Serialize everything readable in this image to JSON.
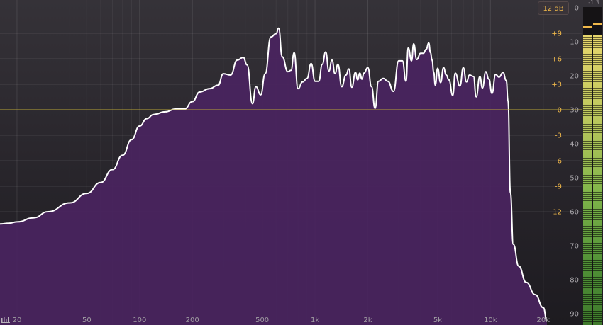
{
  "range_button": {
    "label": "12 dB"
  },
  "peak_readout": "-1.3",
  "gain_scale": [
    {
      "label": "+9",
      "db": 9
    },
    {
      "label": "+6",
      "db": 6
    },
    {
      "label": "+3",
      "db": 3
    },
    {
      "label": "0",
      "db": 0
    },
    {
      "label": "-3",
      "db": -3
    },
    {
      "label": "-6",
      "db": -6
    },
    {
      "label": "-9",
      "db": -9
    },
    {
      "label": "-12",
      "db": -12
    }
  ],
  "level_scale": [
    {
      "label": "0",
      "db": 0
    },
    {
      "label": "-10",
      "db": -10
    },
    {
      "label": "-20",
      "db": -20
    },
    {
      "label": "-30",
      "db": -30
    },
    {
      "label": "-40",
      "db": -40
    },
    {
      "label": "-50",
      "db": -50
    },
    {
      "label": "-60",
      "db": -60
    },
    {
      "label": "-70",
      "db": -70
    },
    {
      "label": "-80",
      "db": -80
    },
    {
      "label": "-90",
      "db": -90
    }
  ],
  "freq_labels": [
    {
      "label": "20",
      "hz": 20
    },
    {
      "label": "50",
      "hz": 50
    },
    {
      "label": "100",
      "hz": 100
    },
    {
      "label": "200",
      "hz": 200
    },
    {
      "label": "500",
      "hz": 500
    },
    {
      "label": "1k",
      "hz": 1000
    },
    {
      "label": "2k",
      "hz": 2000
    },
    {
      "label": "5k",
      "hz": 5000
    },
    {
      "label": "10k",
      "hz": 10000
    },
    {
      "label": "20k",
      "hz": 20000
    }
  ],
  "colors": {
    "spectrum_fill": "#4a2460",
    "spectrum_line": "#ffffff",
    "zero_line": "#b8a437",
    "gain_label": "#f0b84a",
    "level_label": "#a7a4a9",
    "freq_label": "#a19ea3",
    "meter_peak": "#f0b84a"
  },
  "meter": {
    "left_level_db": -8,
    "right_level_db": -8,
    "left_peak_db": -5.5,
    "right_peak_db": -4.5
  },
  "icons": {
    "corner": "analyzer-bars-icon"
  },
  "chart_data": {
    "type": "area",
    "x_scale": "log",
    "x_range_hz": [
      16,
      22000
    ],
    "y_range_db": [
      -92,
      2
    ],
    "points": [
      [
        16,
        -63.6
      ],
      [
        18,
        -63.4
      ],
      [
        20,
        -63
      ],
      [
        25,
        -61.8
      ],
      [
        30,
        -60
      ],
      [
        40,
        -57.4
      ],
      [
        50,
        -54.6
      ],
      [
        60,
        -51.4
      ],
      [
        70,
        -47.6
      ],
      [
        80,
        -43.4
      ],
      [
        90,
        -38.8
      ],
      [
        100,
        -34.8
      ],
      [
        110,
        -32.6
      ],
      [
        120,
        -31.4
      ],
      [
        140,
        -30.6
      ],
      [
        160,
        -29.8
      ],
      [
        180,
        -29.8
      ],
      [
        200,
        -27.6
      ],
      [
        220,
        -24.8
      ],
      [
        250,
        -23.8
      ],
      [
        280,
        -22.8
      ],
      [
        300,
        -19.4
      ],
      [
        330,
        -19.8
      ],
      [
        360,
        -15.4
      ],
      [
        390,
        -14.6
      ],
      [
        410,
        -16.8
      ],
      [
        440,
        -28.2
      ],
      [
        460,
        -23.2
      ],
      [
        490,
        -25.6
      ],
      [
        520,
        -19.4
      ],
      [
        560,
        -8.6
      ],
      [
        600,
        -7.6
      ],
      [
        620,
        -6
      ],
      [
        650,
        -14.4
      ],
      [
        700,
        -18.8
      ],
      [
        730,
        -18.4
      ],
      [
        760,
        -13.2
      ],
      [
        800,
        -23.8
      ],
      [
        850,
        -21.8
      ],
      [
        900,
        -20.8
      ],
      [
        950,
        -16.4
      ],
      [
        1000,
        -21.6
      ],
      [
        1050,
        -21.6
      ],
      [
        1100,
        -16.6
      ],
      [
        1150,
        -13
      ],
      [
        1200,
        -18.6
      ],
      [
        1250,
        -15.4
      ],
      [
        1300,
        -19.4
      ],
      [
        1350,
        -16.6
      ],
      [
        1420,
        -23.2
      ],
      [
        1500,
        -19.8
      ],
      [
        1560,
        -18
      ],
      [
        1620,
        -23.4
      ],
      [
        1700,
        -19
      ],
      [
        1750,
        -21.2
      ],
      [
        1800,
        -19.2
      ],
      [
        1850,
        -21
      ],
      [
        1900,
        -19.2
      ],
      [
        2000,
        -17.6
      ],
      [
        2100,
        -23.2
      ],
      [
        2200,
        -29.6
      ],
      [
        2300,
        -21.6
      ],
      [
        2450,
        -20.8
      ],
      [
        2600,
        -21.6
      ],
      [
        2800,
        -24.6
      ],
      [
        3000,
        -15.6
      ],
      [
        3150,
        -15.6
      ],
      [
        3300,
        -21.6
      ],
      [
        3400,
        -11.8
      ],
      [
        3550,
        -15.6
      ],
      [
        3650,
        -10.6
      ],
      [
        3800,
        -15.2
      ],
      [
        4000,
        -13.4
      ],
      [
        4150,
        -13.4
      ],
      [
        4300,
        -12.2
      ],
      [
        4450,
        -10.4
      ],
      [
        4550,
        -13.2
      ],
      [
        4650,
        -15.4
      ],
      [
        4750,
        -19
      ],
      [
        4850,
        -22.8
      ],
      [
        5000,
        -17.8
      ],
      [
        5200,
        -22
      ],
      [
        5400,
        -17.6
      ],
      [
        5600,
        -19.8
      ],
      [
        5800,
        -21.2
      ],
      [
        6100,
        -25.8
      ],
      [
        6300,
        -19.2
      ],
      [
        6700,
        -23
      ],
      [
        7000,
        -17.6
      ],
      [
        7300,
        -21.8
      ],
      [
        7600,
        -19.8
      ],
      [
        8000,
        -20.2
      ],
      [
        8300,
        -26.2
      ],
      [
        8700,
        -20.2
      ],
      [
        9000,
        -23.6
      ],
      [
        9400,
        -18.8
      ],
      [
        9800,
        -21
      ],
      [
        10200,
        -25.2
      ],
      [
        10700,
        -19.6
      ],
      [
        11200,
        -20.4
      ],
      [
        11800,
        -19
      ],
      [
        12300,
        -21.4
      ],
      [
        12600,
        -27.4
      ],
      [
        13000,
        -54.4
      ],
      [
        13500,
        -69.6
      ],
      [
        14500,
        -76
      ],
      [
        16000,
        -80.8
      ],
      [
        18000,
        -84.4
      ],
      [
        20000,
        -88.2
      ],
      [
        21000,
        -92
      ]
    ]
  }
}
